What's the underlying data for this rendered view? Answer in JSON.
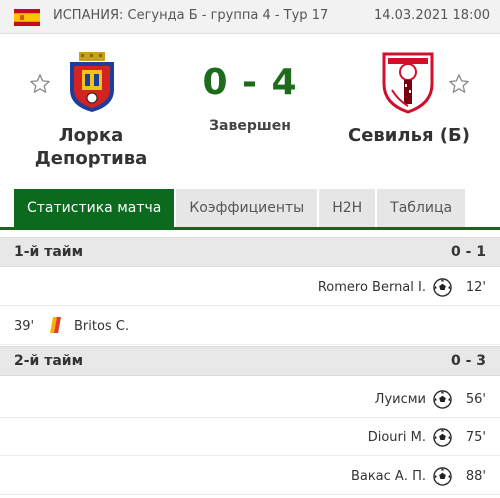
{
  "header": {
    "competition": "ИСПАНИЯ: Сегунда Б - группа 4 - Тур 17",
    "datetime": "14.03.2021 18:00"
  },
  "match": {
    "home_team": "Лорка Депортива",
    "away_team": "Севилья (Б)",
    "score": "0 - 4",
    "status": "Завершен"
  },
  "tabs": [
    "Статистика матча",
    "Коэффициенты",
    "H2H",
    "Таблица"
  ],
  "periods": [
    {
      "label": "1-й тайм",
      "score": "0 - 1",
      "events": [
        {
          "side": "away",
          "type": "goal",
          "player": "Romero Bernal I.",
          "minute": "12'"
        },
        {
          "side": "home",
          "type": "red-card",
          "player": "Britos C.",
          "minute": "39'"
        }
      ]
    },
    {
      "label": "2-й тайм",
      "score": "0 - 3",
      "events": [
        {
          "side": "away",
          "type": "goal",
          "player": "Луисми",
          "minute": "56'"
        },
        {
          "side": "away",
          "type": "goal",
          "player": "Diouri M.",
          "minute": "75'"
        },
        {
          "side": "away",
          "type": "goal",
          "player": "Вакас А. П.",
          "minute": "88'"
        }
      ]
    }
  ],
  "colors": {
    "accent": "#0b6a1e",
    "score": "#1e6b1e",
    "section_bg": "#e8e8e8"
  },
  "icons": {
    "flag": "spain-flag-icon",
    "favorite": "star-icon",
    "goal": "soccer-ball-icon",
    "card": "red-card-icon"
  }
}
